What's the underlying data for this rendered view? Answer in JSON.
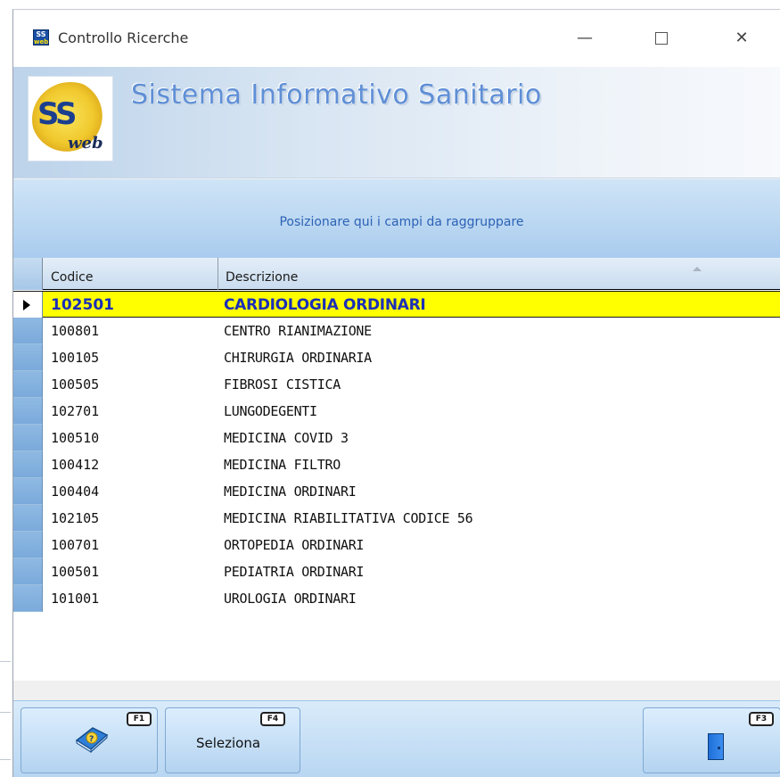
{
  "window": {
    "title": "Controllo Ricerche",
    "app_icon_label": "SS web"
  },
  "banner": {
    "title": "Sistema Informativo Sanitario",
    "logo_main": "SS",
    "logo_sub": "web"
  },
  "group_panel": {
    "hint": "Posizionare qui i campi da raggruppare"
  },
  "grid": {
    "columns": [
      {
        "label": "Codice"
      },
      {
        "label": "Descrizione",
        "sorted": "ascending"
      }
    ],
    "selected_index": 0,
    "rows": [
      {
        "code": "102501",
        "description": "CARDIOLOGIA ORDINARI"
      },
      {
        "code": "100801",
        "description": "CENTRO RIANIMAZIONE"
      },
      {
        "code": "100105",
        "description": "CHIRURGIA ORDINARIA"
      },
      {
        "code": "100505",
        "description": "FIBROSI CISTICA"
      },
      {
        "code": "102701",
        "description": "LUNGODEGENTI"
      },
      {
        "code": "100510",
        "description": "MEDICINA COVID 3"
      },
      {
        "code": "100412",
        "description": "MEDICINA FILTRO"
      },
      {
        "code": "100404",
        "description": "MEDICINA ORDINARI"
      },
      {
        "code": "102105",
        "description": "MEDICINA RIABILITATIVA CODICE 56"
      },
      {
        "code": "100701",
        "description": "ORTOPEDIA ORDINARI"
      },
      {
        "code": "100501",
        "description": "PEDIATRIA ORDINARI"
      },
      {
        "code": "101001",
        "description": "UROLOGIA ORDINARI"
      }
    ]
  },
  "toolbar": {
    "help": {
      "key": "F1",
      "icon": "help-book-icon"
    },
    "select": {
      "key": "F4",
      "label": "Seleziona"
    },
    "exit": {
      "key": "F3",
      "icon": "exit-door-icon"
    }
  },
  "colors": {
    "selected_row_bg": "#ffff00",
    "selected_row_text": "#1c2fb8",
    "banner_title": "#5f8fd6",
    "group_hint": "#2d62b6"
  }
}
